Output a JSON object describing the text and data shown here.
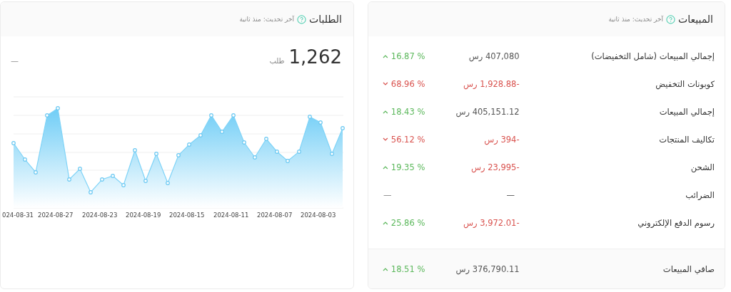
{
  "sales": {
    "title": "المبيعات",
    "subtitle": "آخر تحديث: منذ ثانية",
    "rows": [
      {
        "label": "إجمالي المبيعات (شامل التخفيضات)",
        "value": "407,080 رس",
        "negative": false,
        "change": "16.87 %",
        "caret": true,
        "rising": true
      },
      {
        "label": "كوبونات التخفيض",
        "value": "-1,928.88 رس",
        "negative": true,
        "change": "68.96 %",
        "caret": true,
        "rising": false
      },
      {
        "label": "إجمالي المبيعات",
        "value": "405,151.12 رس",
        "negative": false,
        "change": "18.43 %",
        "caret": true,
        "rising": true
      },
      {
        "label": "تكاليف المنتجات",
        "value": "-394 رس",
        "negative": true,
        "change": "56.12 %",
        "caret": true,
        "rising": false
      },
      {
        "label": "الشحن",
        "value": "-23,995 رس",
        "negative": true,
        "change": "19.35 %",
        "caret": true,
        "rising": true
      },
      {
        "label": "الضرائب",
        "value": "—",
        "negative": false,
        "change": "—",
        "caret": false
      },
      {
        "label": "رسوم الدفع الإلكتروني",
        "value": "-3,972.01 رس",
        "negative": true,
        "change": "25.86 %",
        "caret": true,
        "rising": true
      }
    ],
    "total": {
      "label": "صافي المبيعات",
      "value": "376,790.11 رس",
      "negative": false,
      "change": "18.51 %",
      "caret": true,
      "rising": true
    }
  },
  "orders": {
    "title": "الطلبات",
    "subtitle": "آخر تحديث: منذ ثانية",
    "count": "1,262",
    "unit": "طلب",
    "change": "—",
    "x_labels": [
      "2024-08-03",
      "2024-08-07",
      "2024-08-11",
      "2024-08-15",
      "2024-08-19",
      "2024-08-23",
      "2024-08-27",
      "024-08-31"
    ]
  }
}
